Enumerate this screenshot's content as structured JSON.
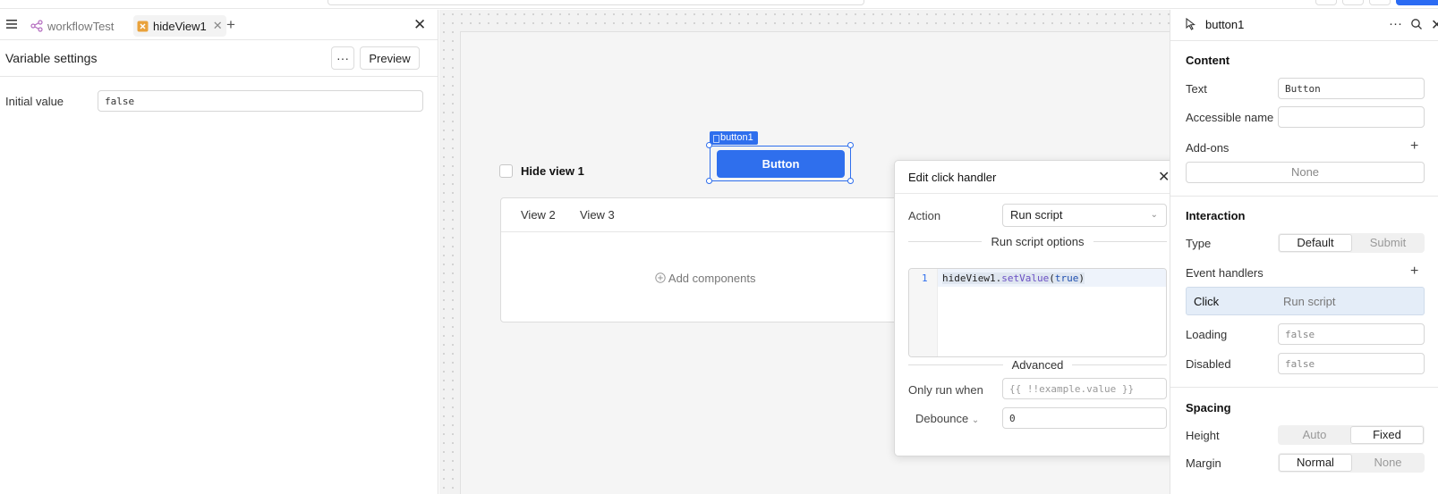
{
  "left_panel": {
    "tabs": [
      {
        "label": "workflowTest",
        "icon": "workflow-icon"
      },
      {
        "label": "hideView1",
        "icon": "variable-icon"
      }
    ],
    "section_title": "Variable settings",
    "more_label": "···",
    "preview_label": "Preview",
    "initial_value_label": "Initial value",
    "initial_value": "false"
  },
  "canvas": {
    "checkbox_label": "Hide view 1",
    "selected_component": "button1",
    "button_text": "Button",
    "view_tabs": [
      "View 2",
      "View 3"
    ],
    "add_components_label": "Add components"
  },
  "popup": {
    "title": "Edit click handler",
    "action_label": "Action",
    "action_value": "Run script",
    "script_options_label": "Run script options",
    "code_line_number": "1",
    "code_object": "hideView1",
    "code_dot": ".",
    "code_fn": "setValue",
    "code_open": "(",
    "code_arg": "true",
    "code_close": ")",
    "advanced_label": "Advanced",
    "only_run_when_label": "Only run when",
    "only_run_when_placeholder": "{{ !!example.value }}",
    "debounce_label": "Debounce",
    "debounce_value": "0"
  },
  "right_panel": {
    "component_name": "button1",
    "content_section": "Content",
    "text_label": "Text",
    "text_value": "Button",
    "accessible_name_label": "Accessible name",
    "accessible_name_value": "",
    "addons_label": "Add-ons",
    "addons_value": "None",
    "interaction_section": "Interaction",
    "type_label": "Type",
    "type_options": [
      "Default",
      "Submit"
    ],
    "type_selected": "Default",
    "event_handlers_label": "Event handlers",
    "event_handler_event": "Click",
    "event_handler_action": "Run script",
    "loading_label": "Loading",
    "loading_value": "false",
    "disabled_label": "Disabled",
    "disabled_value": "false",
    "spacing_section": "Spacing",
    "height_label": "Height",
    "height_options": [
      "Auto",
      "Fixed"
    ],
    "height_selected": "Fixed",
    "margin_label": "Margin",
    "margin_options": [
      "Normal",
      "None"
    ],
    "margin_selected": "Normal"
  },
  "colors": {
    "accent": "#2f6fed",
    "canvas_bg": "#f2f2f2"
  }
}
